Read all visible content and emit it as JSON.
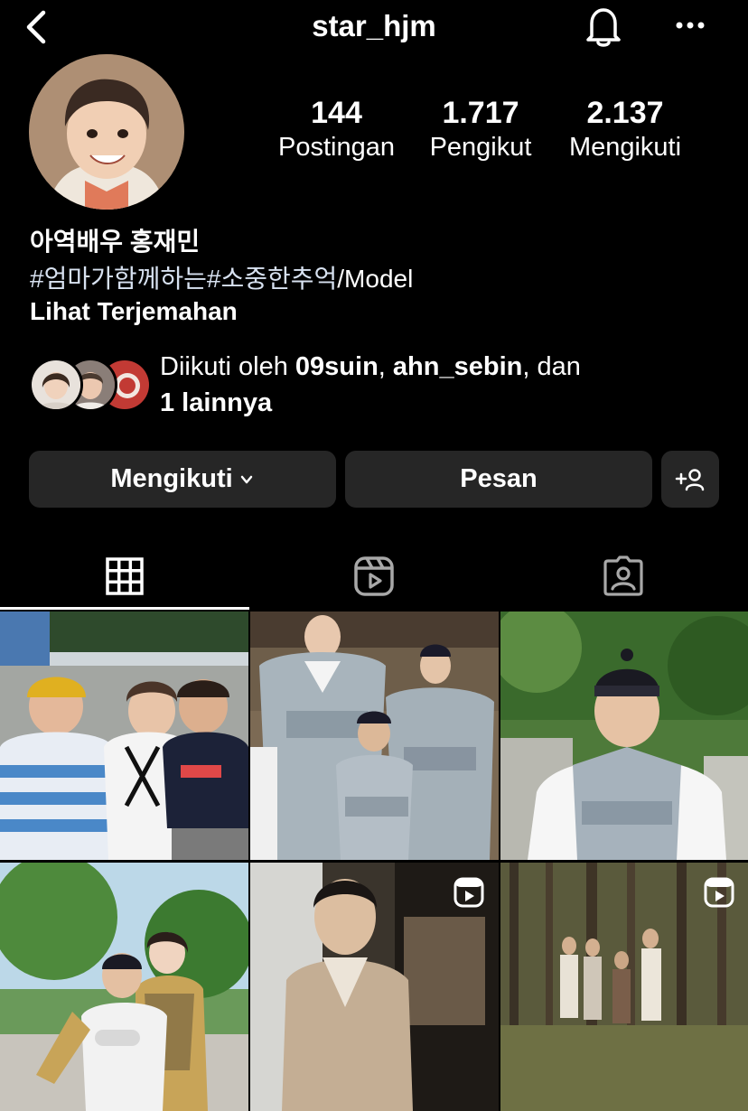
{
  "header": {
    "username": "star_hjm",
    "back_icon": "chevron-left-icon",
    "notification_icon": "bell-icon",
    "more_icon": "more-horizontal-icon"
  },
  "profile": {
    "stats": [
      {
        "value": "144",
        "label": "Postingan"
      },
      {
        "value": "1.717",
        "label": "Pengikut"
      },
      {
        "value": "2.137",
        "label": "Mengikuti"
      }
    ],
    "bio_name": "아역배우 홍재민",
    "bio_tags": "#엄마가함께하는#소중한추억",
    "bio_suffix": "/Model",
    "translate_label": "Lihat Terjemahan"
  },
  "followed_by": {
    "prefix": "Diikuti oleh ",
    "user1": "09suin",
    "sep": ", ",
    "user2": "ahn_sebin",
    "suffix": ", dan",
    "others": "1 lainnya"
  },
  "actions": {
    "follow_label": "Mengikuti",
    "message_label": "Pesan",
    "add_icon": "add-person-icon"
  },
  "tabs": [
    {
      "icon": "grid-icon",
      "active": true
    },
    {
      "icon": "reels-icon",
      "active": false
    },
    {
      "icon": "tagged-icon",
      "active": false
    }
  ],
  "posts": [
    {
      "type": "photo"
    },
    {
      "type": "photo"
    },
    {
      "type": "photo"
    },
    {
      "type": "photo"
    },
    {
      "type": "reel"
    },
    {
      "type": "reel"
    }
  ],
  "colors": {
    "background": "#000000",
    "button": "#262626",
    "hashtag": "#d7e1f0"
  }
}
